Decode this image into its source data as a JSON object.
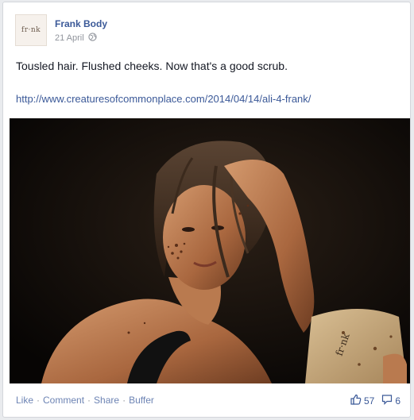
{
  "post": {
    "author": "Frank Body",
    "avatar_text": "fr·nk",
    "date": "21 April",
    "privacy_icon": "globe-icon",
    "text": "Tousled hair. Flushed cheeks. Now that's a good scrub.",
    "link": "http://www.creaturesofcommonplace.com/2014/04/14/ali-4-frank/",
    "photo_bag_text": "fr·nk"
  },
  "actions": {
    "like": "Like",
    "comment": "Comment",
    "share": "Share",
    "buffer": "Buffer",
    "separator": "·"
  },
  "stats": {
    "likes": "57",
    "comments": "6",
    "like_icon": "thumbs-up-icon",
    "comment_icon": "comment-bubble-icon"
  },
  "colors": {
    "link_blue": "#3b5998",
    "action_blue": "#6d84b4",
    "meta_grey": "#90949c"
  }
}
